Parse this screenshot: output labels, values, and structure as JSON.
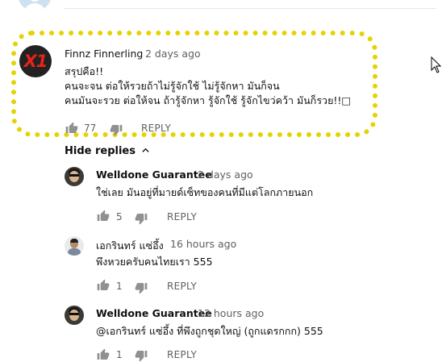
{
  "top_comment": {
    "badge_text": "X1",
    "author": "Finnz Finnerling",
    "time": "2 days ago",
    "lines": [
      "สรุปคือ!!",
      "คนจะจน ต่อให้รวยถ้าไม่รู้จักใช้ ไม่รู้จักหา มันก็จน",
      "คนมันจะรวย ต่อให้จน ถ้ารู้จักหา รู้จักใช้ รู้จักไขว่คว้า มันก็รวย!!□"
    ],
    "like_count": "77",
    "reply_label": "REPLY"
  },
  "hide_replies_label": "Hide replies",
  "replies": [
    {
      "author": "Welldone Guarantee",
      "time": "2 days ago",
      "text": "ใช่เลย มันอยู่ที่มายด์เซ็ทของคนที่มีแต่โลกภายนอก",
      "like_count": "5",
      "reply_label": "REPLY"
    },
    {
      "author": "เอกรินทร์ แซ่อึ้ง",
      "time": "16 hours ago",
      "text": "พึงหวยครับคนไทยเรา 555",
      "like_count": "1",
      "reply_label": "REPLY"
    },
    {
      "author": "Welldone Guarantee",
      "time": "12 hours ago",
      "text": "@เอกรินทร์ แซ่อึ้ง ที่พึงถูกชุดใหญ่ (ถูกแดรกกก) 555",
      "like_count": "1",
      "reply_label": "REPLY"
    }
  ],
  "colors": {
    "highlight": "#e5d300",
    "badge_text": "#e8231b",
    "meta_gray": "#606060"
  }
}
